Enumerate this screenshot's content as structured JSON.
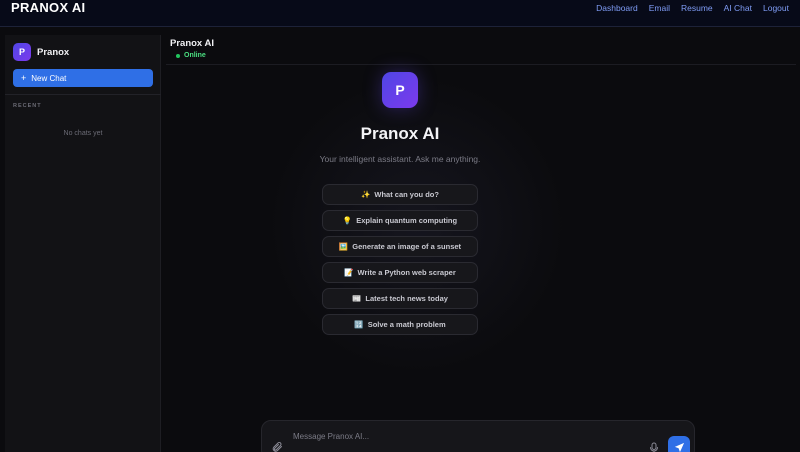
{
  "nav": {
    "brand": "PRANOX AI",
    "links": [
      "Dashboard",
      "Email",
      "Resume",
      "AI Chat",
      "Logout"
    ]
  },
  "sidebar": {
    "logo_letter": "P",
    "title": "Pranox",
    "new_chat_label": "New Chat",
    "recent_label": "RECENT",
    "empty_label": "No chats yet"
  },
  "main": {
    "title": "Pranox AI",
    "status": "Online",
    "logo_letter": "P",
    "hero_title": "Pranox AI",
    "hero_subtitle": "Your intelligent assistant. Ask me anything.",
    "suggestions": [
      {
        "emoji": "✨",
        "label": "What can you do?"
      },
      {
        "emoji": "💡",
        "label": "Explain quantum computing"
      },
      {
        "emoji": "🖼️",
        "label": "Generate an image of a sunset"
      },
      {
        "emoji": "📝",
        "label": "Write a Python web scraper"
      },
      {
        "emoji": "📰",
        "label": "Latest tech news today"
      },
      {
        "emoji": "🔢",
        "label": "Solve a math problem"
      }
    ],
    "composer_placeholder": "Message Pranox AI..."
  },
  "colors": {
    "accent": "#2f6fe6",
    "logo_gradient_start": "#4f46e5",
    "logo_gradient_end": "#7c3aed",
    "online": "#22c55e",
    "nav_link": "#7f9cf5"
  }
}
